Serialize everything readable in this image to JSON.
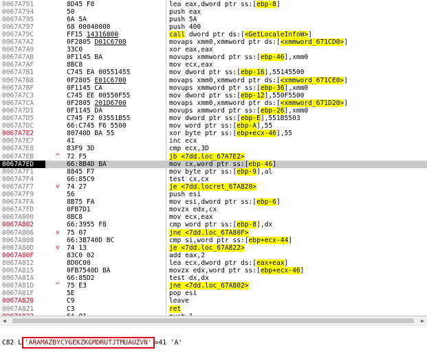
{
  "rows": [
    {
      "addr": "0067A791",
      "addr_red": false,
      "arrow": "",
      "bytes": [
        {
          "t": "8D45 F8"
        }
      ],
      "instr": [
        {
          "t": "lea eax,dword ptr ss:["
        },
        {
          "t": "ebp-8",
          "hl": true
        },
        {
          "t": "]"
        }
      ]
    },
    {
      "addr": "0067A794",
      "addr_red": false,
      "arrow": "",
      "bytes": [
        {
          "t": "50"
        }
      ],
      "instr": [
        {
          "t": "push eax"
        }
      ]
    },
    {
      "addr": "0067A795",
      "addr_red": false,
      "arrow": "",
      "bytes": [
        {
          "t": "6A 5A"
        }
      ],
      "instr": [
        {
          "t": "push 5A"
        }
      ]
    },
    {
      "addr": "0067A797",
      "addr_red": false,
      "arrow": "",
      "bytes": [
        {
          "t": "68 00040000"
        }
      ],
      "instr": [
        {
          "t": "push 400"
        }
      ]
    },
    {
      "addr": "0067A79C",
      "addr_red": false,
      "arrow": "",
      "bytes": [
        {
          "t": "FF15 "
        },
        {
          "t": "14316800",
          "u": true
        }
      ],
      "instr": [
        {
          "t": "call",
          "blk": true
        },
        {
          "t": " dword ptr ds:["
        },
        {
          "t": "<GetLocaleInfoW>",
          "blk": true
        },
        {
          "t": "]"
        }
      ]
    },
    {
      "addr": "0067A7A2",
      "addr_red": false,
      "arrow": "",
      "bytes": [
        {
          "t": "0F2805 "
        },
        {
          "t": "D01C6700",
          "u": true
        }
      ],
      "instr": [
        {
          "t": "movaps xmm0,xmmword ptr ds:["
        },
        {
          "t": "<xmmword_671CD0>",
          "blk": true
        },
        {
          "t": "]"
        }
      ]
    },
    {
      "addr": "0067A7A9",
      "addr_red": false,
      "arrow": "",
      "bytes": [
        {
          "t": "33C0"
        }
      ],
      "instr": [
        {
          "t": "xor eax,eax"
        }
      ]
    },
    {
      "addr": "0067A7AB",
      "addr_red": false,
      "arrow": "",
      "bytes": [
        {
          "t": "0F1145 BA"
        }
      ],
      "instr": [
        {
          "t": "movups xmmword ptr ss:["
        },
        {
          "t": "ebp-46",
          "hl": true
        },
        {
          "t": "],xmm0"
        }
      ]
    },
    {
      "addr": "0067A7AF",
      "addr_red": false,
      "arrow": "",
      "bytes": [
        {
          "t": "8BC8"
        }
      ],
      "instr": [
        {
          "t": "mov ecx,eax"
        }
      ]
    },
    {
      "addr": "0067A7B1",
      "addr_red": false,
      "arrow": "",
      "bytes": [
        {
          "t": "C745 EA 00551455"
        }
      ],
      "instr": [
        {
          "t": "mov dword ptr ss:["
        },
        {
          "t": "ebp-16",
          "hl": true
        },
        {
          "t": "],55145500"
        }
      ]
    },
    {
      "addr": "0067A7B8",
      "addr_red": false,
      "arrow": "",
      "bytes": [
        {
          "t": "0F2805 "
        },
        {
          "t": "E01C6700",
          "u": true
        }
      ],
      "instr": [
        {
          "t": "movaps xmm0,xmmword ptr ds:["
        },
        {
          "t": "<xmmword_671CE0>",
          "blk": true
        },
        {
          "t": "]"
        }
      ]
    },
    {
      "addr": "0067A7BF",
      "addr_red": false,
      "arrow": "",
      "bytes": [
        {
          "t": "0F1145 CA"
        }
      ],
      "instr": [
        {
          "t": "movups xmmword ptr ss:["
        },
        {
          "t": "ebp-36",
          "hl": true
        },
        {
          "t": "],xmm0"
        }
      ]
    },
    {
      "addr": "0067A7C3",
      "addr_red": false,
      "arrow": "",
      "bytes": [
        {
          "t": "C745 EE 00550F55"
        }
      ],
      "instr": [
        {
          "t": "mov dword ptr ss:["
        },
        {
          "t": "ebp-12",
          "hl": true
        },
        {
          "t": "],550F5500"
        }
      ]
    },
    {
      "addr": "0067A7CA",
      "addr_red": false,
      "arrow": "",
      "bytes": [
        {
          "t": "0F2805 "
        },
        {
          "t": "201D6700",
          "u": true
        }
      ],
      "instr": [
        {
          "t": "movaps xmm0,xmmword ptr ds:["
        },
        {
          "t": "<xmmword_671D20>",
          "blk": true
        },
        {
          "t": "]"
        }
      ]
    },
    {
      "addr": "0067A7D1",
      "addr_red": false,
      "arrow": "",
      "bytes": [
        {
          "t": "0F1145 DA"
        }
      ],
      "instr": [
        {
          "t": "movups xmmword ptr ss:["
        },
        {
          "t": "ebp-26",
          "hl": true
        },
        {
          "t": "],xmm0"
        }
      ]
    },
    {
      "addr": "0067A7D5",
      "addr_red": false,
      "arrow": "",
      "bytes": [
        {
          "t": "C745 F2 03551B55"
        }
      ],
      "instr": [
        {
          "t": "mov dword ptr ss:["
        },
        {
          "t": "ebp-E",
          "hl": true
        },
        {
          "t": "],551B5503"
        }
      ]
    },
    {
      "addr": "0067A7DC",
      "addr_red": false,
      "arrow": "",
      "bytes": [
        {
          "t": "66:C745 F6 5500"
        }
      ],
      "instr": [
        {
          "t": "mov word ptr ss:["
        },
        {
          "t": "ebp-A",
          "hl": true
        },
        {
          "t": "],55"
        }
      ]
    },
    {
      "addr": "0067A7E2",
      "addr_red": true,
      "arrow": "",
      "bytes": [
        {
          "t": "80740D BA 55"
        }
      ],
      "instr": [
        {
          "t": "xor byte ptr ss:["
        },
        {
          "t": "ebp+ecx-46",
          "hl": true
        },
        {
          "t": "],55"
        }
      ]
    },
    {
      "addr": "0067A7E7",
      "addr_red": false,
      "arrow": "",
      "bytes": [
        {
          "t": "41"
        }
      ],
      "instr": [
        {
          "t": "inc ecx"
        }
      ]
    },
    {
      "addr": "0067A7E8",
      "addr_red": false,
      "arrow": "",
      "bytes": [
        {
          "t": "83F9 3D"
        }
      ],
      "instr": [
        {
          "t": "cmp ecx,3D"
        }
      ]
    },
    {
      "addr": "0067A7EB",
      "addr_red": false,
      "arrow": "^",
      "bytes": [
        {
          "t": "72 F5"
        }
      ],
      "instr": [
        {
          "t": "jb <7dd.loc_67A7E2>",
          "blk": true
        }
      ]
    },
    {
      "addr": "0067A7ED",
      "addr_red": false,
      "arrow": "",
      "sel": true,
      "bytes": [
        {
          "t": "66:8B4D BA"
        }
      ],
      "instr": [
        {
          "t": "mov cx,word ptr ss:["
        },
        {
          "t": "ebp-46",
          "hl": true
        },
        {
          "t": "]"
        }
      ]
    },
    {
      "addr": "0067A7F1",
      "addr_red": false,
      "arrow": "",
      "bytes": [
        {
          "t": "8845 F7"
        }
      ],
      "instr": [
        {
          "t": "mov byte ptr ss:["
        },
        {
          "t": "ebp-9",
          "hl": true
        },
        {
          "t": "],al"
        }
      ]
    },
    {
      "addr": "0067A7F4",
      "addr_red": false,
      "arrow": "",
      "bytes": [
        {
          "t": "66:85C9"
        }
      ],
      "instr": [
        {
          "t": "test cx,cx"
        }
      ]
    },
    {
      "addr": "0067A7F7",
      "addr_red": false,
      "arrow": "v",
      "bytes": [
        {
          "t": "74 27"
        }
      ],
      "instr": [
        {
          "t": "je <7dd.locret_67A820>",
          "blk": true
        }
      ]
    },
    {
      "addr": "0067A7F9",
      "addr_red": false,
      "arrow": "",
      "bytes": [
        {
          "t": "56"
        }
      ],
      "instr": [
        {
          "t": "push esi"
        }
      ]
    },
    {
      "addr": "0067A7FA",
      "addr_red": false,
      "arrow": "",
      "bytes": [
        {
          "t": "8B75 FA"
        }
      ],
      "instr": [
        {
          "t": "mov esi,dword ptr ss:["
        },
        {
          "t": "ebp-6",
          "hl": true
        },
        {
          "t": "]"
        }
      ]
    },
    {
      "addr": "0067A7FD",
      "addr_red": false,
      "arrow": "",
      "bytes": [
        {
          "t": "0FB7D1"
        }
      ],
      "instr": [
        {
          "t": "movzx edx,cx"
        }
      ]
    },
    {
      "addr": "0067A800",
      "addr_red": false,
      "arrow": "",
      "bytes": [
        {
          "t": "8BC8"
        }
      ],
      "instr": [
        {
          "t": "mov ecx,eax"
        }
      ]
    },
    {
      "addr": "0067A802",
      "addr_red": true,
      "arrow": "",
      "bytes": [
        {
          "t": "66:3955 F8"
        }
      ],
      "instr": [
        {
          "t": "cmp word ptr ss:["
        },
        {
          "t": "ebp-8",
          "hl": true
        },
        {
          "t": "],dx"
        }
      ]
    },
    {
      "addr": "0067A806",
      "addr_red": false,
      "arrow": "v",
      "bytes": [
        {
          "t": "75 07"
        }
      ],
      "instr": [
        {
          "t": "jne <7dd.loc_67A80F>",
          "blk": true
        }
      ]
    },
    {
      "addr": "0067A808",
      "addr_red": false,
      "arrow": "",
      "bytes": [
        {
          "t": "66:3B740D BC"
        }
      ],
      "instr": [
        {
          "t": "cmp si,word ptr ss:["
        },
        {
          "t": "ebp+ecx-44",
          "hl": true
        },
        {
          "t": "]"
        }
      ]
    },
    {
      "addr": "0067A80D",
      "addr_red": false,
      "arrow": "v",
      "bytes": [
        {
          "t": "74 13"
        }
      ],
      "instr": [
        {
          "t": "je <7dd.loc_67A822>",
          "blk": true
        }
      ]
    },
    {
      "addr": "0067A80F",
      "addr_red": true,
      "arrow": "",
      "bytes": [
        {
          "t": "83C0 02"
        }
      ],
      "instr": [
        {
          "t": "add eax,2"
        }
      ]
    },
    {
      "addr": "0067A812",
      "addr_red": false,
      "arrow": "",
      "bytes": [
        {
          "t": "8D0C00"
        }
      ],
      "instr": [
        {
          "t": "lea ecx,dword ptr ds:["
        },
        {
          "t": "eax+eax",
          "hl": true
        },
        {
          "t": "]"
        }
      ]
    },
    {
      "addr": "0067A815",
      "addr_red": false,
      "arrow": "",
      "bytes": [
        {
          "t": "0FB7540D BA"
        }
      ],
      "instr": [
        {
          "t": "movzx edx,word ptr ss:["
        },
        {
          "t": "ebp+ecx-46",
          "hl": true
        },
        {
          "t": "]"
        }
      ]
    },
    {
      "addr": "0067A81A",
      "addr_red": false,
      "arrow": "",
      "bytes": [
        {
          "t": "66:85D2"
        }
      ],
      "instr": [
        {
          "t": "test dx,dx"
        }
      ]
    },
    {
      "addr": "0067A81D",
      "addr_red": false,
      "arrow": "^",
      "bytes": [
        {
          "t": "75 E3"
        }
      ],
      "instr": [
        {
          "t": "jne <7dd.loc_67A802>",
          "blk": true
        }
      ]
    },
    {
      "addr": "0067A81F",
      "addr_red": false,
      "arrow": "",
      "bytes": [
        {
          "t": "5E"
        }
      ],
      "instr": [
        {
          "t": "pop esi"
        }
      ]
    },
    {
      "addr": "0067A820",
      "addr_red": true,
      "arrow": "",
      "bytes": [
        {
          "t": "C9"
        }
      ],
      "instr": [
        {
          "t": "leave"
        }
      ]
    },
    {
      "addr": "0067A821",
      "addr_red": false,
      "arrow": "",
      "bytes": [
        {
          "t": "C3"
        }
      ],
      "instr": [
        {
          "t": "ret",
          "blk": true
        }
      ]
    },
    {
      "addr": "0067A822",
      "addr_red": true,
      "arrow": "",
      "bytes": [
        {
          "t": "6A 01"
        }
      ],
      "instr": [
        {
          "t": "push 1"
        }
      ]
    }
  ],
  "infobar": {
    "prefix": "C82 L",
    "string_quote_open": "'",
    "string_value": "ARAMAZBYCYGEKZKGMDRUTJTMUAUZVN",
    "string_quote_close": "'",
    "suffix": "=41 'A'"
  },
  "colors": {
    "address_gray": "#808080",
    "address_red": "#e0001b",
    "highlight_yellow": "#ffff00",
    "selected_row": "#c8c8c8",
    "annotation_box_red": "#e0001b"
  },
  "icons": {
    "scroll_left": "◀",
    "scroll_right": "▶"
  }
}
